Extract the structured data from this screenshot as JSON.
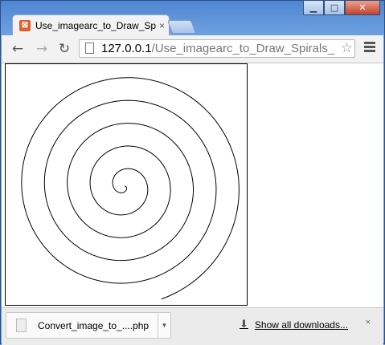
{
  "window": {
    "minimize_icon": "minimize-icon",
    "maximize_icon": "maximize-icon",
    "close_icon": "close-icon"
  },
  "tab": {
    "title": "Use_imagearc_to_Draw_Spi",
    "favicon": "xampp-icon",
    "close": "×"
  },
  "toolbar": {
    "back": "←",
    "forward": "→",
    "reload": "↻",
    "url_host": "127.0.0.1",
    "url_path": "/Use_imagearc_to_Draw_Spirals_",
    "star": "☆"
  },
  "content": {
    "image": "spiral-image"
  },
  "downloads": {
    "file_name": "Convert_image_to_....php",
    "show_all": "Show all downloads...",
    "close": "×"
  }
}
